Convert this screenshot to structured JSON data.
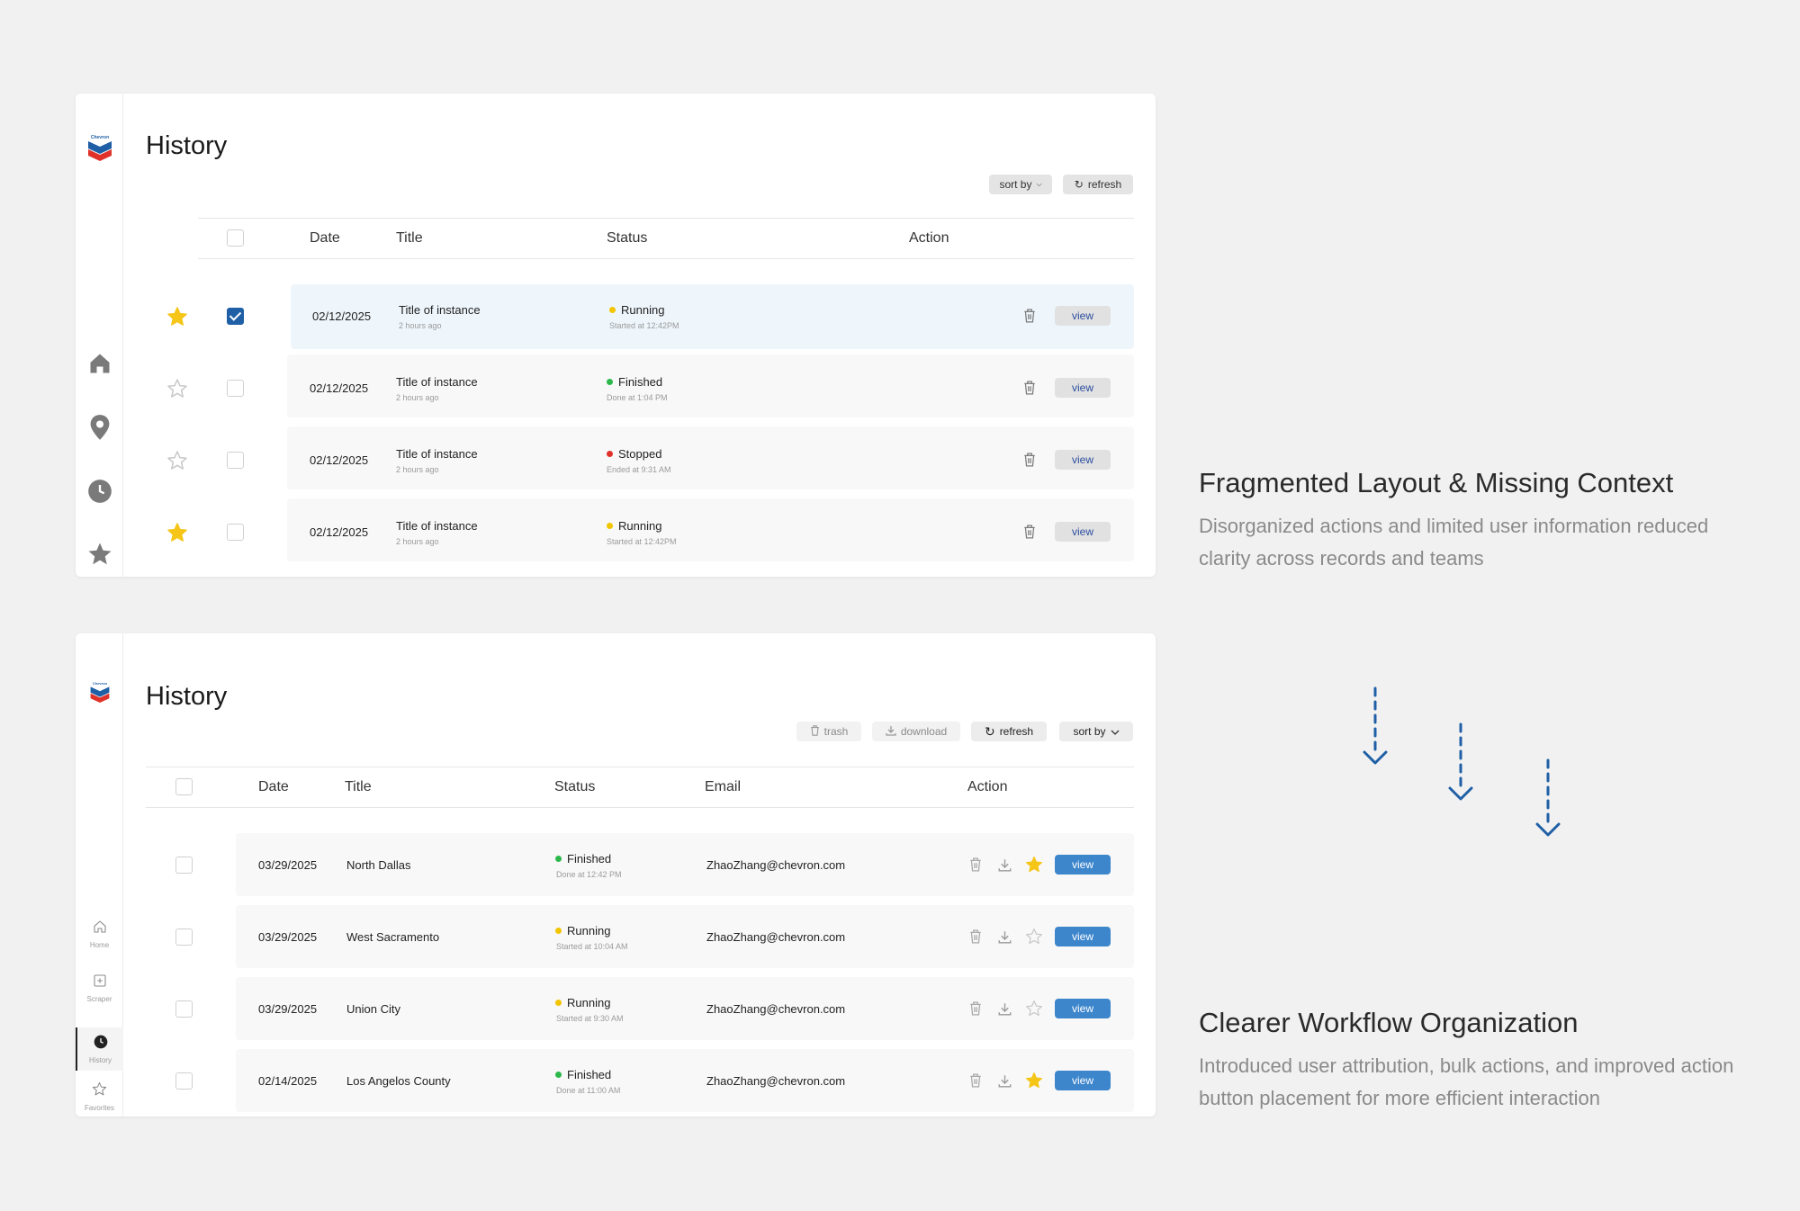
{
  "before": {
    "title": "History",
    "sort_label": "sort by",
    "refresh_label": "refresh",
    "columns": {
      "date": "Date",
      "title": "Title",
      "status": "Status",
      "action": "Action"
    },
    "rows": [
      {
        "date": "02/12/2025",
        "title": "Title of instance",
        "sub": "2 hours ago",
        "status": "Running",
        "status_color": "#f2c500",
        "status_sub": "Started at 12:42PM",
        "starred": true,
        "checked": true,
        "action": "view"
      },
      {
        "date": "02/12/2025",
        "title": "Title of instance",
        "sub": "2 hours ago",
        "status": "Finished",
        "status_color": "#2cb84a",
        "status_sub": "Done at 1:04 PM",
        "starred": false,
        "checked": false,
        "action": "view"
      },
      {
        "date": "02/12/2025",
        "title": "Title of instance",
        "sub": "2 hours ago",
        "status": "Stopped",
        "status_color": "#e0312b",
        "status_sub": "Ended at 9:31 AM",
        "starred": false,
        "checked": false,
        "action": "view"
      },
      {
        "date": "02/12/2025",
        "title": "Title of instance",
        "sub": "2 hours ago",
        "status": "Running",
        "status_color": "#f2c500",
        "status_sub": "Started at 12:42PM",
        "starred": true,
        "checked": false,
        "action": "view"
      }
    ]
  },
  "after": {
    "title": "History",
    "toolbar": {
      "trash": "trash",
      "download": "download",
      "refresh": "refresh",
      "sort": "sort by"
    },
    "columns": {
      "date": "Date",
      "title": "Title",
      "status": "Status",
      "email": "Email",
      "action": "Action"
    },
    "nav": [
      {
        "label": "Home",
        "icon": "home-icon"
      },
      {
        "label": "Scraper",
        "icon": "plus-square-icon"
      },
      {
        "label": "History",
        "icon": "clock-icon",
        "active": true
      },
      {
        "label": "Favorites",
        "icon": "star-icon"
      }
    ],
    "rows": [
      {
        "date": "03/29/2025",
        "title": "North Dallas",
        "status": "Finished",
        "status_color": "#2cb84a",
        "status_sub": "Done at 12:42 PM",
        "email": "ZhaoZhang@chevron.com",
        "starred": true,
        "action": "view"
      },
      {
        "date": "03/29/2025",
        "title": "West Sacramento",
        "status": "Running",
        "status_color": "#f2c500",
        "status_sub": "Started at 10:04 AM",
        "email": "ZhaoZhang@chevron.com",
        "starred": false,
        "action": "view"
      },
      {
        "date": "03/29/2025",
        "title": "Union City",
        "status": "Running",
        "status_color": "#f2c500",
        "status_sub": "Started at 9:30 AM",
        "email": "ZhaoZhang@chevron.com",
        "starred": false,
        "action": "view"
      },
      {
        "date": "02/14/2025",
        "title": "Los Angelos County",
        "status": "Finished",
        "status_color": "#2cb84a",
        "status_sub": "Done at 11:00 AM",
        "email": "ZhaoZhang@chevron.com",
        "starred": true,
        "action": "view"
      }
    ]
  },
  "annotations": {
    "before_heading": "Fragmented Layout & Missing Context",
    "before_desc": "Disorganized actions and limited user information reduced clarity across records and teams",
    "after_heading": "Clearer Workflow Organization",
    "after_desc": "Introduced user attribution, bulk actions, and improved action button placement for more efficient interaction"
  },
  "colors": {
    "accent_blue": "#3d86cc",
    "arrow_blue": "#1f5fa6",
    "star_yellow": "#f5c518",
    "checkbox_blue": "#1f5fa6"
  }
}
